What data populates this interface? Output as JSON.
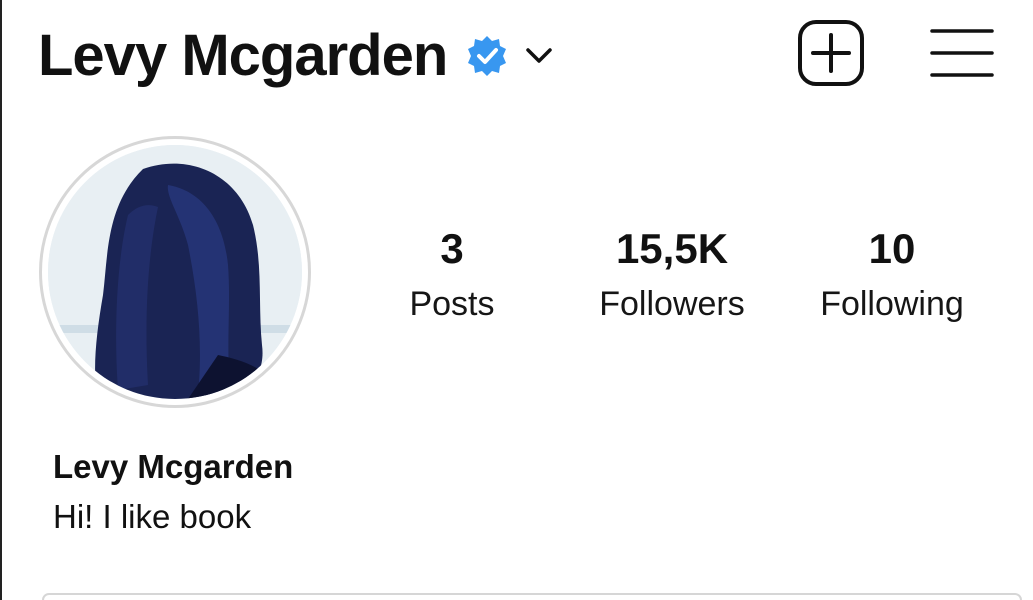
{
  "header": {
    "username": "Levy Mcgarden",
    "verified_color": "#3897f0",
    "icons": {
      "verified": "verified-badge-icon",
      "chevron": "chevron-down-icon",
      "add": "add-post-icon",
      "menu": "hamburger-menu-icon"
    }
  },
  "profile": {
    "avatar_alt": "profile-photo",
    "stats": {
      "posts": {
        "value": "3",
        "label": "Posts"
      },
      "followers": {
        "value": "15,5K",
        "label": "Followers"
      },
      "following": {
        "value": "10",
        "label": "Following"
      }
    },
    "display_name": "Levy Mcgarden",
    "bio": "Hi! I like book"
  }
}
